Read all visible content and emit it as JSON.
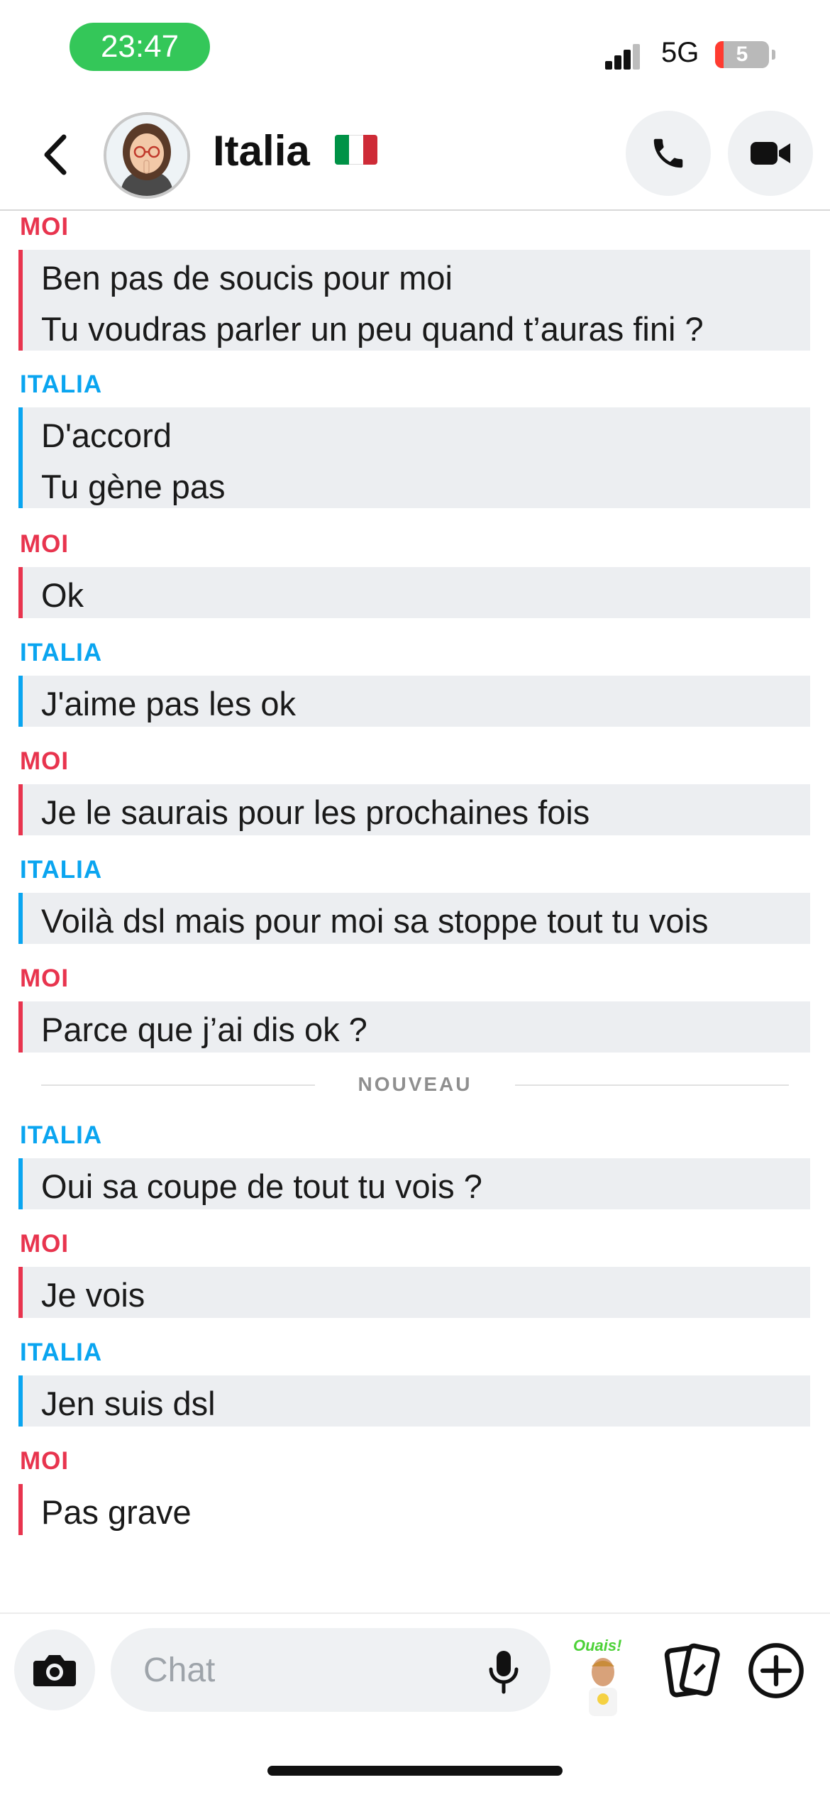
{
  "status_bar": {
    "time": "23:47",
    "network": "5G",
    "battery_level": "5"
  },
  "header": {
    "contact_name": "Italia",
    "flag_colors": [
      "#009246",
      "#ffffff",
      "#ce2b37"
    ]
  },
  "colors": {
    "me_accent": "#e8344e",
    "them_accent": "#0aa5f0",
    "bubble_bg": "#eceef1"
  },
  "messages": [
    {
      "sender": "MOI",
      "lines": [
        "Ben pas de soucis pour moi",
        "Tu voudras parler un peu quand t’auras fini ?"
      ]
    },
    {
      "sender": "ITALIA",
      "lines": [
        "D'accord",
        "Tu gène pas"
      ]
    },
    {
      "sender": "MOI",
      "lines": [
        "Ok"
      ]
    },
    {
      "sender": "ITALIA",
      "lines": [
        "J'aime pas les ok"
      ]
    },
    {
      "sender": "MOI",
      "lines": [
        "Je le saurais pour les prochaines fois"
      ]
    },
    {
      "sender": "ITALIA",
      "lines": [
        "Voilà dsl mais pour moi sa stoppe tout tu vois"
      ]
    },
    {
      "sender": "MOI",
      "lines": [
        "Parce que j’ai dis ok ?"
      ]
    },
    {
      "sender": "ITALIA",
      "lines": [
        "Oui sa coupe de tout tu vois ?"
      ]
    },
    {
      "sender": "MOI",
      "lines": [
        "Je vois"
      ]
    },
    {
      "sender": "ITALIA",
      "lines": [
        "Jen suis dsl"
      ]
    },
    {
      "sender": "MOI",
      "lines": [
        "Pas grave"
      ]
    }
  ],
  "new_divider_label": "NOUVEAU",
  "input": {
    "placeholder": "Chat"
  },
  "sticker_label": "Ouais!"
}
